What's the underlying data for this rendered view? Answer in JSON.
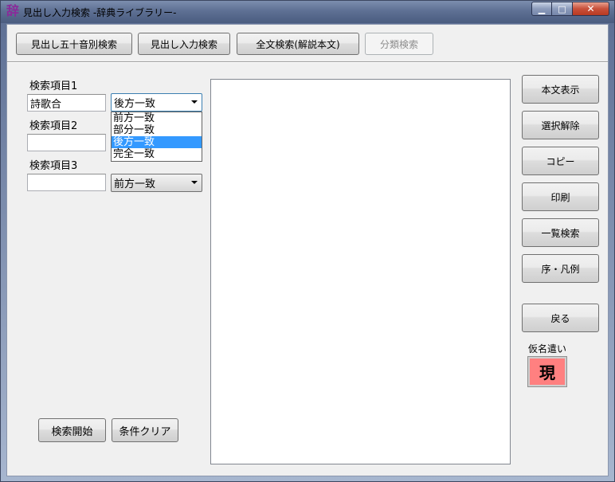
{
  "window": {
    "icon_glyph": "辞",
    "title": "見出し入力検索 -辞典ライブラリー-",
    "minimize_glyph": "▁",
    "maximize_glyph": "□",
    "close_glyph": "✕"
  },
  "toolbar": {
    "gojuon_search": "見出し五十音別検索",
    "heading_input_search": "見出し入力検索",
    "fulltext_search": "全文検索(解説本文)",
    "category_search": "分類検索"
  },
  "search": {
    "item1_label": "検索項目1",
    "item1_value": "詩歌合",
    "item1_match": "後方一致",
    "item2_label": "検索項目2",
    "item2_value": "",
    "item3_label": "検索項目3",
    "item3_value": "",
    "item3_match": "前方一致",
    "match_options": [
      "前方一致",
      "部分一致",
      "後方一致",
      "完全一致"
    ],
    "start_button": "検索開始",
    "clear_button": "条件クリア"
  },
  "side": {
    "show_body": "本文表示",
    "deselect": "選択解除",
    "copy": "コピー",
    "print": "印刷",
    "list_search": "一覧検索",
    "preface": "序・凡例",
    "back": "戻る",
    "kana_label": "仮名遣い",
    "kana_value": "現",
    "kana_color": "#ff8080"
  }
}
